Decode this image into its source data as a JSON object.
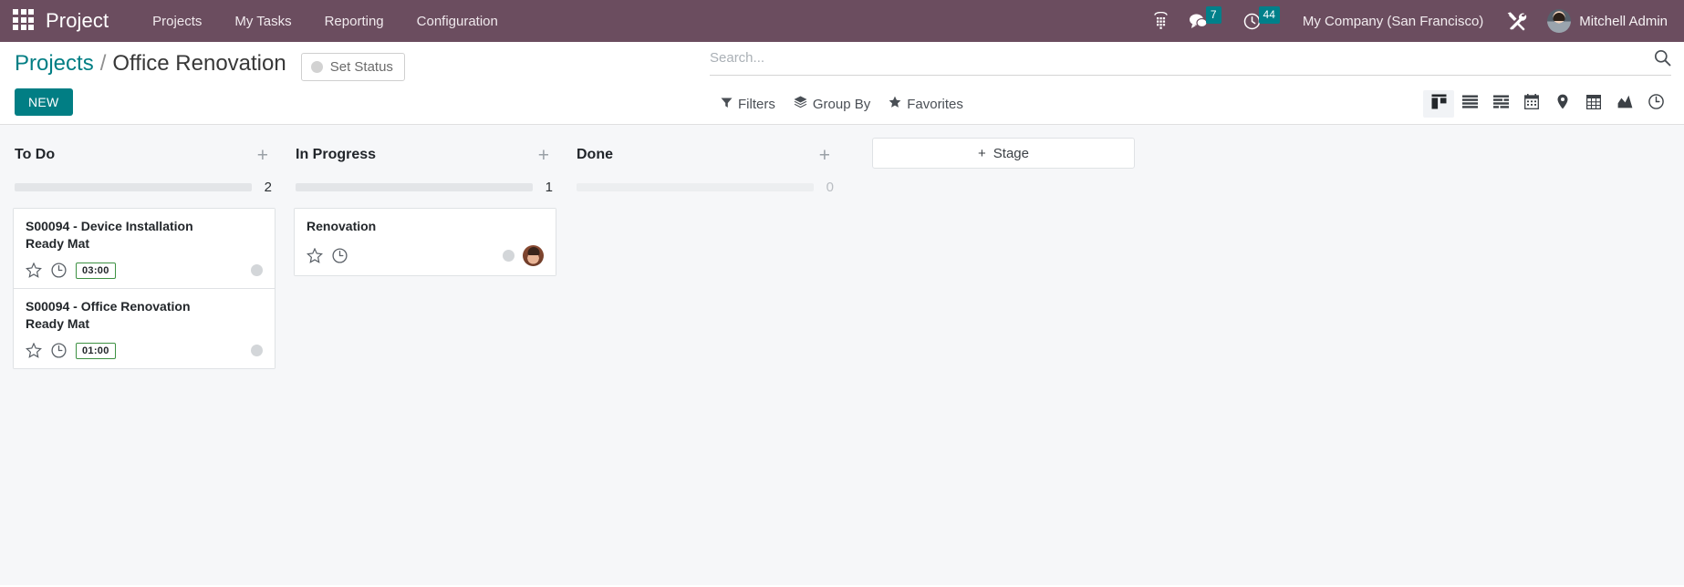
{
  "navbar": {
    "apps_icon": "apps-grid-icon",
    "brand": "Project",
    "menu": [
      {
        "label": "Projects"
      },
      {
        "label": "My Tasks"
      },
      {
        "label": "Reporting"
      },
      {
        "label": "Configuration"
      }
    ],
    "icons": [
      {
        "name": "dialpad-icon",
        "badge": null
      },
      {
        "name": "messages-icon",
        "badge": "7"
      },
      {
        "name": "activities-clock-icon",
        "badge": "44"
      }
    ],
    "company": "My Company (San Francisco)",
    "tools_icon": "tools-wrench-screwdriver-icon",
    "user": "Mitchell Admin",
    "avatar": "user-avatar",
    "bg_color": "#6b4d5f",
    "badge_color": "#00808a"
  },
  "control_panel": {
    "breadcrumb": {
      "root": "Projects",
      "separator": "/",
      "current": "Office Renovation",
      "root_color": "#017e84"
    },
    "set_status": {
      "label": "Set Status",
      "dot_icon": "status-circle-icon"
    },
    "new_button": {
      "label": "NEW",
      "color": "#017e84"
    },
    "search": {
      "placeholder": "Search...",
      "value": "",
      "icon": "search-magnifier-icon"
    },
    "filters": [
      {
        "label": "Filters",
        "icon": "funnel-icon"
      },
      {
        "label": "Group By",
        "icon": "layers-icon"
      },
      {
        "label": "Favorites",
        "icon": "star-icon"
      }
    ],
    "views": [
      {
        "name": "kanban-view",
        "icon": "kanban-icon",
        "active": true
      },
      {
        "name": "list-view",
        "icon": "list-icon",
        "active": false
      },
      {
        "name": "gantt-view",
        "icon": "gantt-icon",
        "active": false
      },
      {
        "name": "calendar-view",
        "icon": "calendar-icon",
        "active": false
      },
      {
        "name": "map-view",
        "icon": "map-pin-icon",
        "active": false
      },
      {
        "name": "pivot-view",
        "icon": "pivot-table-icon",
        "active": false
      },
      {
        "name": "graph-view",
        "icon": "graph-chart-icon",
        "active": false
      },
      {
        "name": "activity-view",
        "icon": "activity-clock-icon",
        "active": false
      }
    ]
  },
  "kanban": {
    "columns": [
      {
        "title": "To Do",
        "count": "2",
        "add_icon": "plus-icon",
        "cards": [
          {
            "title": "S00094 - Device Installation",
            "subtitle": "Ready Mat",
            "star_icon": "star-outline-icon",
            "clock_icon": "clock-outline-icon",
            "time": "03:00",
            "time_border_color": "#3d9142",
            "state_dot": "state-dot-grey",
            "avatar": null
          },
          {
            "title": "S00094 - Office Renovation",
            "subtitle": "Ready Mat",
            "star_icon": "star-outline-icon",
            "clock_icon": "clock-outline-icon",
            "time": "01:00",
            "time_border_color": "#3d9142",
            "state_dot": "state-dot-grey",
            "avatar": null
          }
        ]
      },
      {
        "title": "In Progress",
        "count": "1",
        "add_icon": "plus-icon",
        "cards": [
          {
            "title": "Renovation",
            "subtitle": "",
            "star_icon": "star-outline-icon",
            "clock_icon": "clock-outline-icon",
            "time": "",
            "state_dot": "state-dot-grey",
            "avatar": "assignee-avatar"
          }
        ]
      },
      {
        "title": "Done",
        "count": "0",
        "add_icon": "plus-icon",
        "cards": []
      }
    ],
    "stage_adder": {
      "label": "Stage",
      "plus": "+"
    }
  }
}
